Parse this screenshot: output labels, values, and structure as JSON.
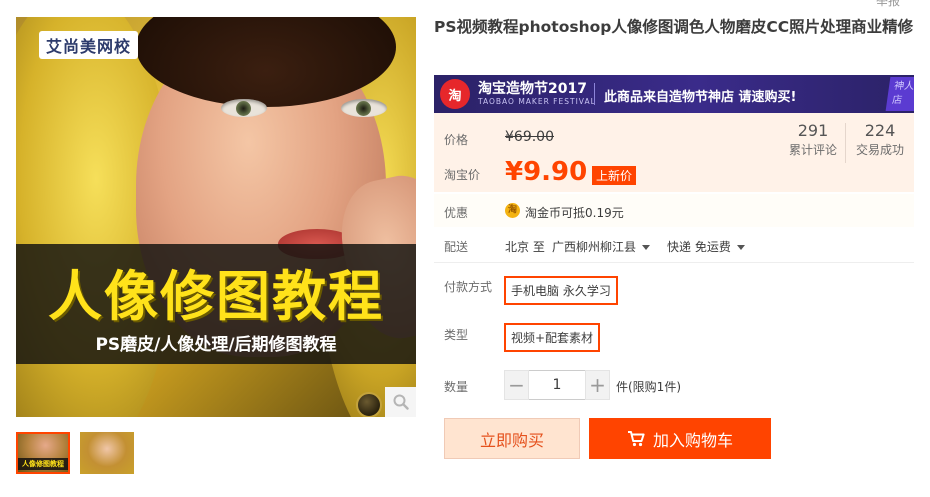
{
  "corner": {
    "text": "举报"
  },
  "gallery": {
    "logo": "艾尚美网校",
    "banner_title": "人像修图教程",
    "banner_subtitle": "PS磨皮/人像处理/后期修图教程",
    "thumb_label": "人像修图教程"
  },
  "product": {
    "title": "PS视频教程photoshop人像修图调色人物磨皮CC照片处理商业精修"
  },
  "promo": {
    "logo_char": "淘",
    "festival": "淘宝造物节2017",
    "festival_en": "TAOBAO MAKER FESTIVAL",
    "message": "此商品来自造物节神店 请速购买!",
    "corner_text": "神人 店"
  },
  "price": {
    "label": "价格",
    "original": "¥69.00",
    "promo_label": "淘宝价",
    "promo_value": "¥9.90",
    "promo_tag": "上新价"
  },
  "stats": {
    "reviews": {
      "value": "291",
      "label": "累计评论"
    },
    "deals": {
      "value": "224",
      "label": "交易成功"
    }
  },
  "coupon": {
    "label": "优惠",
    "icon_char": "淘",
    "text": "淘金币可抵0.19元"
  },
  "shipping": {
    "label": "配送",
    "from": "北京 至",
    "to": "广西柳州柳江县",
    "method": "快递 免运费"
  },
  "options": {
    "payment_label": "付款方式",
    "payment_value": "手机电脑 永久学习",
    "type_label": "类型",
    "type_value": "视频+配套素材"
  },
  "quantity": {
    "label": "数量",
    "minus": "−",
    "value": "1",
    "plus": "+",
    "note": "件(限购1件)"
  },
  "actions": {
    "buy_now": "立即购买",
    "add_cart": "加入购物车"
  }
}
